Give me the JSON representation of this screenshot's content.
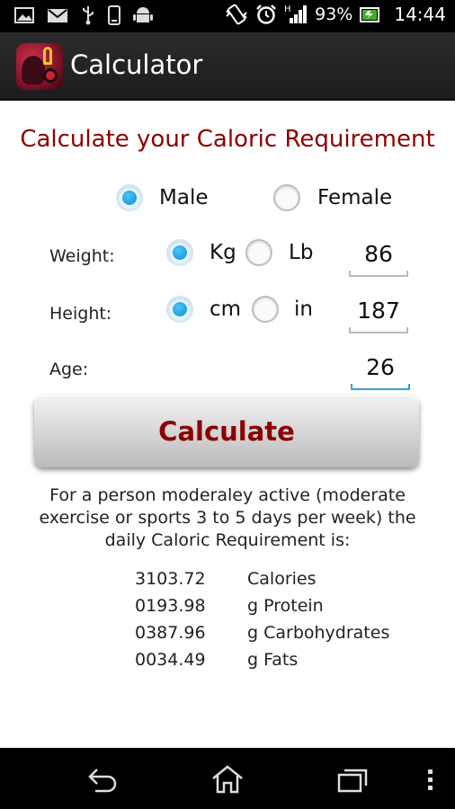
{
  "status_bar": {
    "icons_left": [
      "image-icon",
      "mail-icon",
      "usb-icon",
      "device-icon",
      "android-icon"
    ],
    "icons_right": [
      "vibrate-icon",
      "alarm-icon",
      "signal-icon"
    ],
    "network_type": "H",
    "battery_percent": "93%",
    "time": "14:44"
  },
  "action_bar": {
    "title": "Calculator"
  },
  "form": {
    "heading": "Calculate your Caloric Requirement",
    "gender": {
      "male_label": "Male",
      "female_label": "Female",
      "selected": "Male"
    },
    "weight": {
      "label": "Weight:",
      "unit_kg": "Kg",
      "unit_lb": "Lb",
      "selected_unit": "Kg",
      "value": "86"
    },
    "height": {
      "label": "Height:",
      "unit_cm": "cm",
      "unit_in": "in",
      "selected_unit": "cm",
      "value": "187"
    },
    "age": {
      "label": "Age:",
      "value": "26"
    },
    "calculate_label": "Calculate"
  },
  "result": {
    "description_lines": [
      "For a person moderaley active (moderate",
      "exercise or sports 3 to 5 days per week) the",
      "daily Caloric Requirement is:"
    ],
    "rows": [
      {
        "value": "3103.72",
        "unit": "Calories"
      },
      {
        "value": "0193.98",
        "unit": "g Protein"
      },
      {
        "value": "0387.96",
        "unit": "g Carbohydrates"
      },
      {
        "value": "0034.49",
        "unit": "g Fats"
      }
    ]
  },
  "colors": {
    "accent_red": "#8b0000",
    "radio_blue": "#0a8fd6",
    "focus_blue": "#33a3d9"
  },
  "nav_bar": {
    "buttons": [
      "back-icon",
      "home-icon",
      "recent-apps-icon",
      "overflow-menu-icon"
    ]
  }
}
